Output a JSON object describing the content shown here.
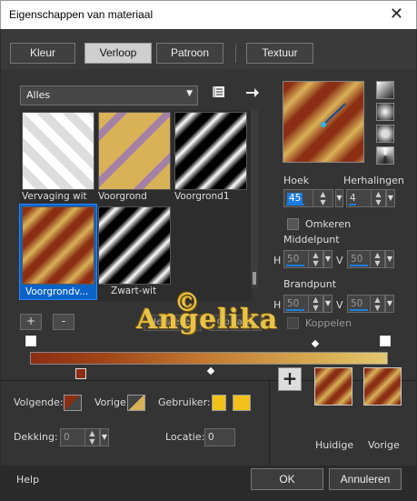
{
  "window": {
    "title": "Eigenschappen van materiaal",
    "close_glyph": "✕"
  },
  "tabs": [
    {
      "label": "Kleur",
      "active": false
    },
    {
      "label": "Verloop",
      "active": true
    },
    {
      "label": "Patroon",
      "active": false
    },
    {
      "label": "Textuur",
      "active": false
    }
  ],
  "category_dropdown": {
    "value": "Alles"
  },
  "gradients": [
    {
      "label": "Vervaging wit",
      "selected": false
    },
    {
      "label": "Voorgrond",
      "selected": false
    },
    {
      "label": "Voorgrond1",
      "selected": false
    },
    {
      "label": "Voorgrondv...",
      "selected": true
    },
    {
      "label": "Zwart-wit",
      "selected": false
    }
  ],
  "list_buttons": {
    "add": "+",
    "remove": "-"
  },
  "overlay_buttons": {
    "reset": "Herstellen",
    "save": "Opslaan"
  },
  "angle": {
    "label": "Hoek",
    "value": "45"
  },
  "repeats": {
    "label": "Herhalingen",
    "value": "4"
  },
  "invert": {
    "label": "Omkeren",
    "checked": false
  },
  "center": {
    "label": "Middelpunt",
    "h_label": "H",
    "h_value": "50",
    "v_label": "V",
    "v_value": "50"
  },
  "focal": {
    "label": "Brandpunt",
    "h_label": "H",
    "h_value": "50",
    "v_label": "V",
    "v_value": "50"
  },
  "link": {
    "label": "Koppelen",
    "checked": false
  },
  "bottom": {
    "next_label": "Volgende:",
    "prev_label": "Vorige:",
    "user_label": "Gebruiker:",
    "opacity_label": "Dekking:",
    "opacity_value": "0",
    "location_label": "Locatie:",
    "location_value": "0",
    "add_button": "+",
    "current_label": "Huidige",
    "previous_label": "Vorige"
  },
  "footer": {
    "help": "Help",
    "ok": "OK",
    "cancel": "Annuleren"
  },
  "watermark": {
    "text": "Angelika",
    "symbol": "©"
  },
  "colors": {
    "selection": "#0a64c8",
    "gradient_dark": "#8b2e14",
    "gradient_light": "#e3c770",
    "user_swatch": "#f2c21a",
    "spin_accent": "#1c7de0"
  }
}
